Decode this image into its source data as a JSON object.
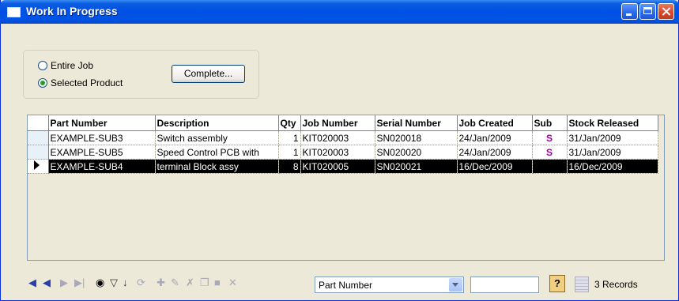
{
  "window": {
    "title": "Work In Progress"
  },
  "options": {
    "entire_job_label": "Entire Job",
    "selected_product_label": "Selected Product",
    "complete_button": "Complete..."
  },
  "grid": {
    "columns": [
      "Part Number",
      "Description",
      "Qty",
      "Job Number",
      "Serial Number",
      "Job Created",
      "Sub",
      "Stock Released"
    ],
    "rows": [
      {
        "part": "EXAMPLE-SUB3",
        "desc": "Switch assembly",
        "qty": "1",
        "job": "KIT020003",
        "serial": "SN020018",
        "created": "24/Jan/2009",
        "sub": "S",
        "released": "31/Jan/2009"
      },
      {
        "part": "EXAMPLE-SUB5",
        "desc": "Speed Control PCB with",
        "qty": "1",
        "job": "KIT020003",
        "serial": "SN020020",
        "created": "24/Jan/2009",
        "sub": "S",
        "released": "31/Jan/2009"
      },
      {
        "part": "EXAMPLE-SUB4",
        "desc": "terminal Block assy",
        "qty": "8",
        "job": "KIT020005",
        "serial": "SN020021",
        "created": "16/Dec/2009",
        "sub": "",
        "released": "16/Dec/2009"
      }
    ]
  },
  "navbar": {
    "search_field": "Part Number",
    "record_count": "3 Records"
  }
}
